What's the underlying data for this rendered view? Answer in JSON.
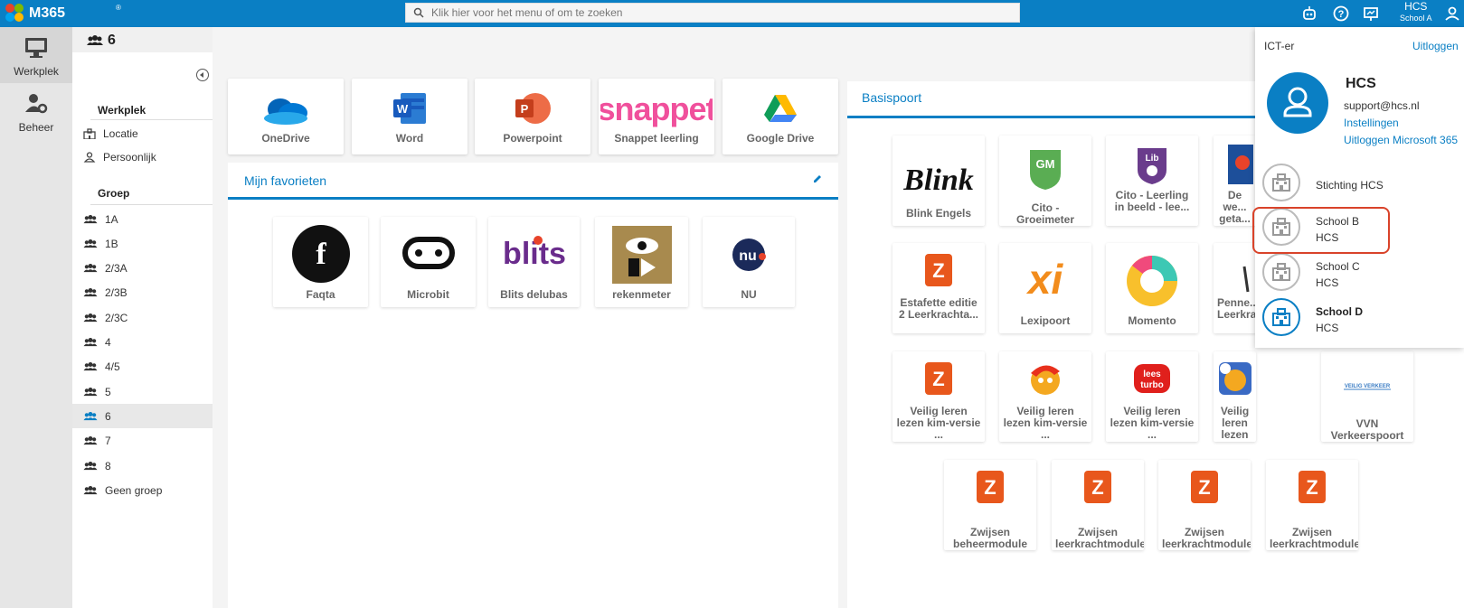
{
  "app": {
    "title": "M365",
    "reg_mark": "®"
  },
  "search": {
    "placeholder": "Klik hier voor het menu of om te zoeken"
  },
  "user": {
    "name": "HCS",
    "school": "School A"
  },
  "rail": [
    {
      "label": "Werkplek",
      "icon": "monitor-icon"
    },
    {
      "label": "Beheer",
      "icon": "user-gear-icon"
    }
  ],
  "group_header": {
    "label": "6"
  },
  "sidebar": {
    "section_werkplek": "Werkplek",
    "werkplek_items": [
      "Locatie",
      "Persoonlijk"
    ],
    "section_groep": "Groep",
    "groups": [
      "1A",
      "1B",
      "2/3A",
      "2/3B",
      "2/3C",
      "4",
      "4/5",
      "5",
      "6",
      "7",
      "8",
      "Geen groep"
    ],
    "active_group": "6"
  },
  "top_apps": [
    "OneDrive",
    "Word",
    "Powerpoint",
    "Snappet leerling",
    "Google Drive"
  ],
  "favorites": {
    "title": "Mijn favorieten",
    "items": [
      "Faqta",
      "Microbit",
      "Blits delubas",
      "rekenmeter",
      "NU"
    ]
  },
  "basispoort": {
    "title": "Basispoort",
    "rows": [
      [
        "Blink Engels",
        "Cito - Groeimeter",
        "Cito - Leerling in beeld - lee...",
        "De we... geta..."
      ],
      [
        "Estafette editie 2 Leerkrachta...",
        "Lexipoort",
        "Momento",
        "Penne... Leerkra..."
      ],
      [
        "Veilig leren lezen kim-versie ...",
        "Veilig leren lezen kim-versie ...",
        "Veilig leren lezen kim-versie ...",
        "Veilig leren lezen kim-versie ...",
        "VVN Verkeerspoort"
      ],
      [
        "Zwijsen beheermodule",
        "Zwijsen leerkrachtmodule",
        "Zwijsen leerkrachtmodule",
        "Zwijsen leerkrachtmodule"
      ]
    ],
    "logo_text": {
      "blink": "Blink",
      "gm": "GM",
      "lib": "Lib",
      "xi": "xi",
      "z": "Z",
      "lees": "lees",
      "turbo": "turbo",
      "vvn": "VEILIG VERKEER",
      "snappet": "snappet",
      "nu": "nu",
      "blits": "blits"
    }
  },
  "dropdown": {
    "role": "ICT-er",
    "logout": "Uitloggen",
    "name": "HCS",
    "email": "support@hcs.nl",
    "settings": "Instellingen",
    "logout_ms": "Uitloggen Microsoft 365",
    "schools": [
      {
        "name": "Stichting HCS",
        "sub": ""
      },
      {
        "name": "School B",
        "sub": "HCS"
      },
      {
        "name": "School C",
        "sub": "HCS"
      },
      {
        "name": "School D",
        "sub": "HCS"
      }
    ]
  },
  "colors": {
    "brand": "#0a7fc4",
    "highlight": "#d9432a",
    "zwijsen": "#e8571c"
  }
}
